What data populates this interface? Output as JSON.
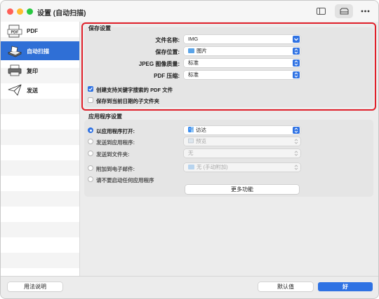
{
  "window": {
    "title": "设置 (自动扫描)"
  },
  "sidebar": {
    "items": [
      {
        "label": "PDF",
        "icon": "pdf-icon",
        "active": false
      },
      {
        "label": "自动扫描",
        "icon": "scanner-icon",
        "active": true
      },
      {
        "label": "复印",
        "icon": "printer-icon",
        "active": false
      },
      {
        "label": "发送",
        "icon": "paper-plane-icon",
        "active": false
      }
    ]
  },
  "save_settings": {
    "title": "保存设置",
    "file_name_label": "文件名称:",
    "file_name_value": "IMG",
    "save_location_label": "保存位置:",
    "save_location_value": "图片",
    "jpeg_quality_label": "JPEG 图像质量:",
    "jpeg_quality_value": "标准",
    "pdf_compression_label": "PDF 压缩:",
    "pdf_compression_value": "标准",
    "searchable_pdf_label": "创建支持关键字搜索的 PDF 文件",
    "date_subfolder_label": "保存到当前日期的子文件夹"
  },
  "app_settings": {
    "title": "应用程序设置",
    "open_with_label": "以应用程序打开:",
    "open_with_value": "访达",
    "send_to_app_label": "发送到应用程序:",
    "send_to_app_value": "预览",
    "send_to_folder_label": "发送到文件夹:",
    "send_to_folder_value": "无",
    "attach_email_label": "附加到电子邮件:",
    "attach_email_value": "无 (手动附加)",
    "no_app_label": "请不要启动任何应用程序",
    "more_functions_label": "更多功能"
  },
  "footer": {
    "help_label": "用法说明",
    "defaults_label": "默认值",
    "ok_label": "好"
  },
  "colors": {
    "accent": "#2f72e3",
    "sidebar_active": "#2f6fd6",
    "highlight_border": "#e0202a"
  }
}
